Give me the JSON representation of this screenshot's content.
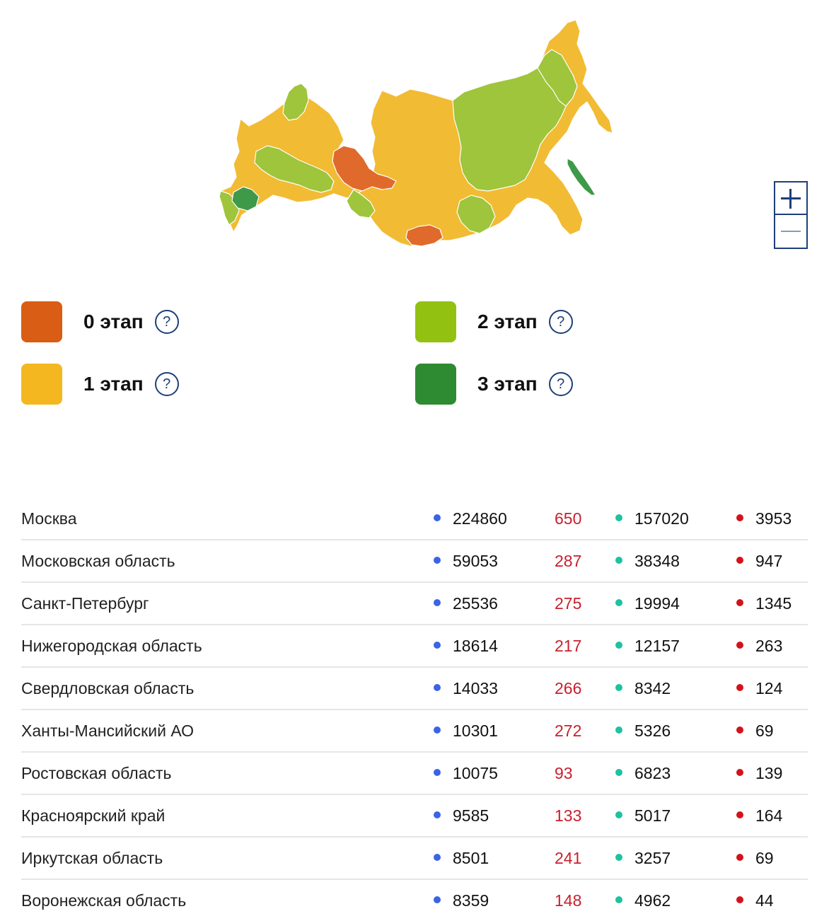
{
  "map": {
    "colors": {
      "stage0": "#e06a2b",
      "stage1": "#f2bb34",
      "stage2": "#9ec53b",
      "stage3": "#3e9a48"
    },
    "regions": [
      {
        "name": "Ханты-Мансийский АО",
        "stage": 0
      },
      {
        "name": "Тыва",
        "stage": 0
      },
      {
        "name": "Ростовская область",
        "stage": 3
      },
      {
        "name": "Сахалинская область",
        "stage": 3
      }
    ]
  },
  "legend": [
    {
      "label": "0 этап",
      "color": "#d95d14"
    },
    {
      "label": "1 этап",
      "color": "#f4b71f"
    },
    {
      "label": "2 этап",
      "color": "#93c112"
    },
    {
      "label": "3 этап",
      "color": "#2e8b32"
    }
  ],
  "help_glyph": "?",
  "table": {
    "dot_colors": {
      "cases": "#3b63e8",
      "recovered": "#1ec2a0",
      "deaths": "#d5111c"
    },
    "rows": [
      {
        "region": "Москва",
        "cases": "224860",
        "new": "650",
        "recovered": "157020",
        "deaths": "3953"
      },
      {
        "region": "Московская область",
        "cases": "59053",
        "new": "287",
        "recovered": "38348",
        "deaths": "947"
      },
      {
        "region": "Санкт-Петербург",
        "cases": "25536",
        "new": "275",
        "recovered": "19994",
        "deaths": "1345"
      },
      {
        "region": "Нижегородская область",
        "cases": "18614",
        "new": "217",
        "recovered": "12157",
        "deaths": "263"
      },
      {
        "region": "Свердловская область",
        "cases": "14033",
        "new": "266",
        "recovered": "8342",
        "deaths": "124"
      },
      {
        "region": "Ханты-Мансийский АО",
        "cases": "10301",
        "new": "272",
        "recovered": "5326",
        "deaths": "69"
      },
      {
        "region": "Ростовская область",
        "cases": "10075",
        "new": "93",
        "recovered": "6823",
        "deaths": "139"
      },
      {
        "region": "Красноярский край",
        "cases": "9585",
        "new": "133",
        "recovered": "5017",
        "deaths": "164"
      },
      {
        "region": "Иркутская область",
        "cases": "8501",
        "new": "241",
        "recovered": "3257",
        "deaths": "69"
      },
      {
        "region": "Воронежская область",
        "cases": "8359",
        "new": "148",
        "recovered": "4962",
        "deaths": "44"
      }
    ]
  }
}
